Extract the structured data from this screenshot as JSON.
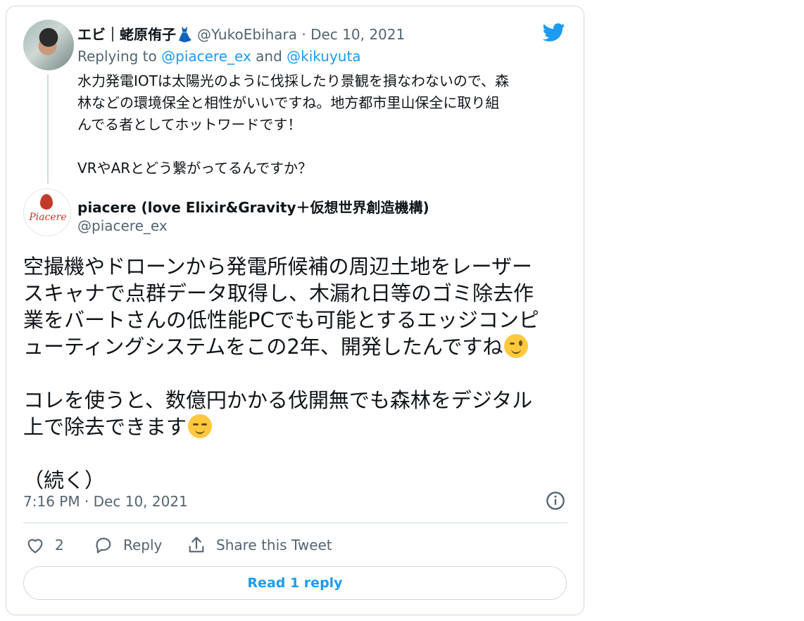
{
  "reply_tweet": {
    "display_name": "エビ｜蛯原侑子👗",
    "handle": "@YukoEbihara",
    "separator": " · ",
    "date": "Dec 10, 2021",
    "replying_prefix": "Replying to ",
    "replying_user1": "@piacere_ex",
    "replying_and": " and ",
    "replying_user2": "@kikuyuta",
    "text": "水力発電IOTは太陽光のように伐採したり景観を損なわないので、森\n林などの環境保全と相性がいいですね。地方都市里山保全に取り組\nんでる者としてホットワードです！\n\nVRやARとどう繋がってるんですか？"
  },
  "main_tweet": {
    "display_name": "piacere (love Elixir&Gravity＋仮想世界創造機構)",
    "handle": "@piacere_ex",
    "avatar_text": "Piacere",
    "line1": "空撮機やドローンから発電所候補の周辺土地をレーザー\nスキャナで点群データ取得し、木漏れ日等のゴミ除去作\n業をバートさんの低性能PCでも可能とするエッジコンピ\nューティングシステムをこの2年、開発したんですね",
    "emoji1": "wink-emoji",
    "line2": "\nコレを使うと、数億円かかる伐開無でも森林をデジタル\n上で除去できます",
    "emoji2": "relieved-emoji",
    "line3": "\n（続く）",
    "timestamp": "7:16 PM · Dec 10, 2021"
  },
  "actions": {
    "like_count": "2",
    "reply_label": "Reply",
    "share_label": "Share this Tweet",
    "read_replies_label": "Read 1 reply"
  },
  "colors": {
    "accent": "#1d9bf0",
    "muted": "#536471",
    "border": "#cfd9de"
  }
}
